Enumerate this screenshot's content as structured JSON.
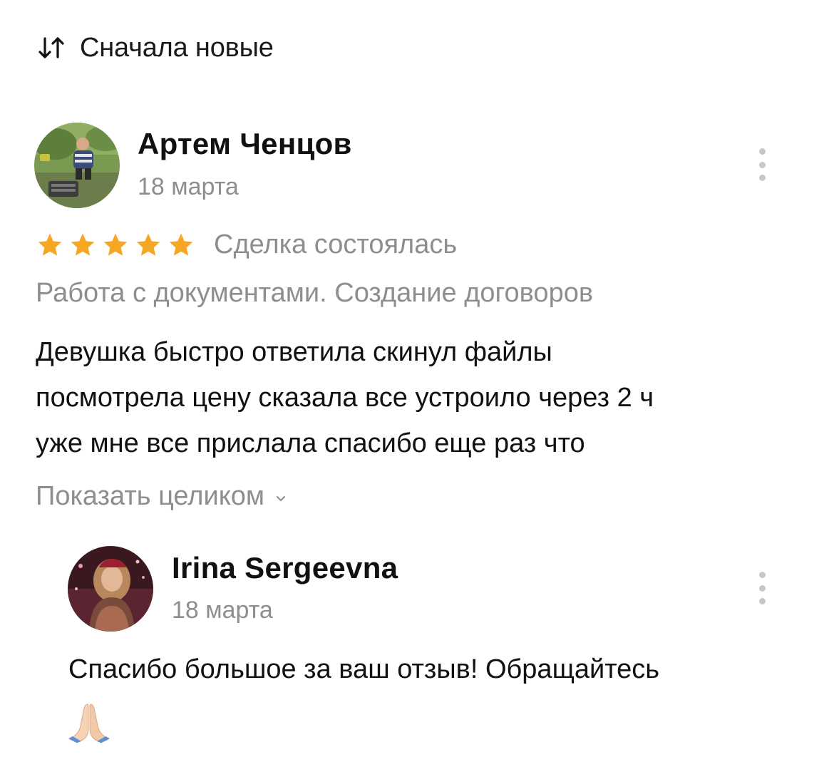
{
  "sort": {
    "icon": "sort-arrows-icon",
    "label": "Сначала новые"
  },
  "review": {
    "author": "Артем Ченцов",
    "date": "18 марта",
    "avatar": "user-photo-avatar",
    "rating": 5,
    "rating_max": 5,
    "star_color": "#F5A623",
    "deal_status": "Сделка состоялась",
    "service": "Работа с документами. Создание договоров",
    "text_lines": [
      "Девушка быстро ответила скинул файлы",
      "посмотрела цену сказала все устроило через 2 ч",
      "уже мне все прислала спасибо еще раз что"
    ],
    "show_more_label": "Показать целиком",
    "menu_icon": "more-vertical-icon"
  },
  "reply": {
    "author": "Irina Sergeevna",
    "date": "18 марта",
    "avatar": "user-photo-avatar",
    "text": "Спасибо большое за ваш отзыв! Обращайтесь",
    "emoji": "praying-hands-emoji",
    "menu_icon": "more-vertical-icon"
  }
}
